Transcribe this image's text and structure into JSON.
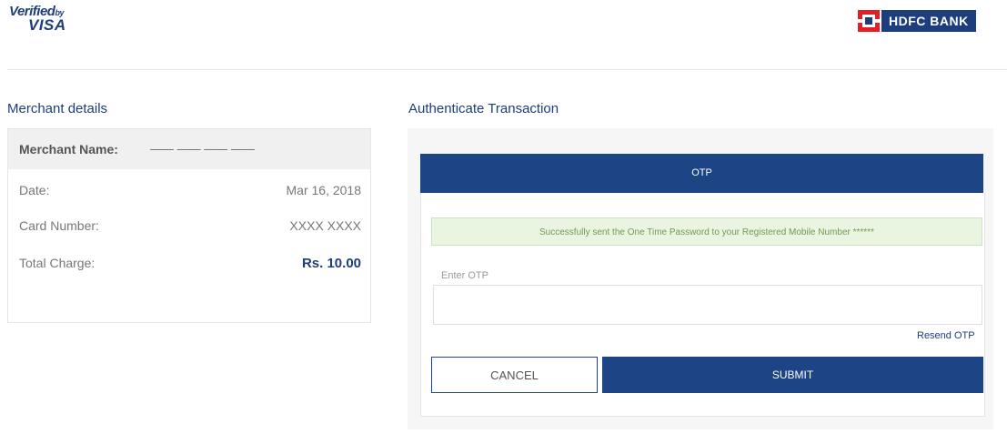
{
  "branding": {
    "visa_line1": "Verified",
    "visa_by": "by",
    "visa_line2": "VISA",
    "bank_name": "HDFC BANK",
    "bank_mark_icon": "hdfc-logo-icon",
    "brand_color": "#1d4485",
    "bank_red": "#e31e24"
  },
  "merchant": {
    "title": "Merchant details",
    "name_label": "Merchant Name:",
    "name_value": "——  —— —— ——",
    "date_label": "Date:",
    "date_value": "Mar 16, 2018",
    "card_label": "Card Number:",
    "card_value": "XXXX XXXX",
    "total_label": "Total Charge:",
    "total_value": "Rs. 10.00"
  },
  "auth": {
    "title": "Authenticate Transaction",
    "tab_label": "OTP",
    "success_message": "Successfully sent the One Time Password to your Registered Mobile Number ******",
    "otp_label": "Enter OTP",
    "otp_value": "",
    "resend_label": "Resend OTP",
    "cancel_label": "CANCEL",
    "submit_label": "SUBMIT"
  }
}
